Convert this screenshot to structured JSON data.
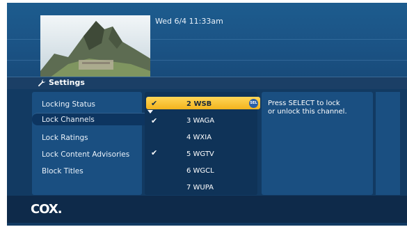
{
  "header": {
    "datetime": "Wed 6/4  11:33am"
  },
  "section": {
    "title": "Settings",
    "icon": "wrench-icon"
  },
  "menu": {
    "items": [
      {
        "label": "Locking Status"
      },
      {
        "label": "Lock Channels",
        "selected": true
      },
      {
        "label": "Lock Ratings"
      },
      {
        "label": "Lock Content Advisories"
      },
      {
        "label": "Block Titles"
      }
    ]
  },
  "channels": [
    {
      "label": "2 WSB",
      "locked": true,
      "highlighted": true
    },
    {
      "label": "3 WAGA",
      "locked": true
    },
    {
      "label": "4 WXIA",
      "locked": false
    },
    {
      "label": "5 WGTV",
      "locked": true
    },
    {
      "label": "6 WGCL",
      "locked": false
    },
    {
      "label": "7 WUPA",
      "locked": false
    }
  ],
  "select_badge": "SEL",
  "help_text": "Press SELECT to lock\nor unlock this channel.",
  "footer": {
    "logo": "COX."
  },
  "colors": {
    "highlight": "#f3b41d",
    "background": "#123a62",
    "panel": "#1a4f81"
  }
}
